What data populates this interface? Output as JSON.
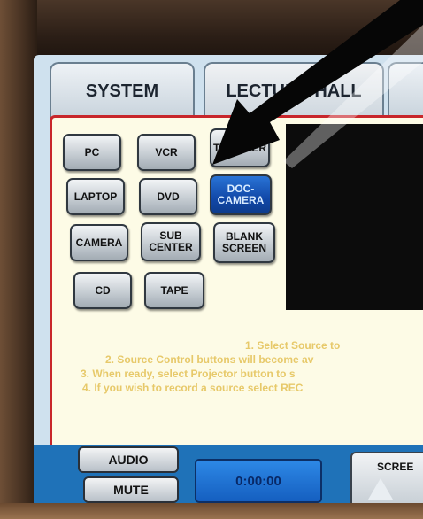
{
  "tabs": [
    {
      "label": "SYSTEM"
    },
    {
      "label": "LECTURE HALL"
    }
  ],
  "sources": {
    "pc": "PC",
    "vcr": "VCR",
    "tv_tuner": "TV TUNER",
    "laptop": "LAPTOP",
    "dvd": "DVD",
    "doc_camera": "DOC-\nCAMERA",
    "camera": "CAMERA",
    "sub_center": "SUB\nCENTER",
    "blank_screen": "BLANK\nSCREEN",
    "cd": "CD",
    "tape": "TAPE"
  },
  "instructions": [
    "1. Select Source to",
    "2. Source Control buttons will become av",
    "3. When ready, select Projector button to s",
    "4. If you wish to record a source select REC"
  ],
  "bottom": {
    "audio_label": "AUDIO",
    "mute_label": "MUTE",
    "timer": "0:00:00",
    "screen_label": "SCREE"
  },
  "colors": {
    "active_source": "#1148a8",
    "panel_border": "#c8262b",
    "instruction_text": "#e7c96a"
  }
}
